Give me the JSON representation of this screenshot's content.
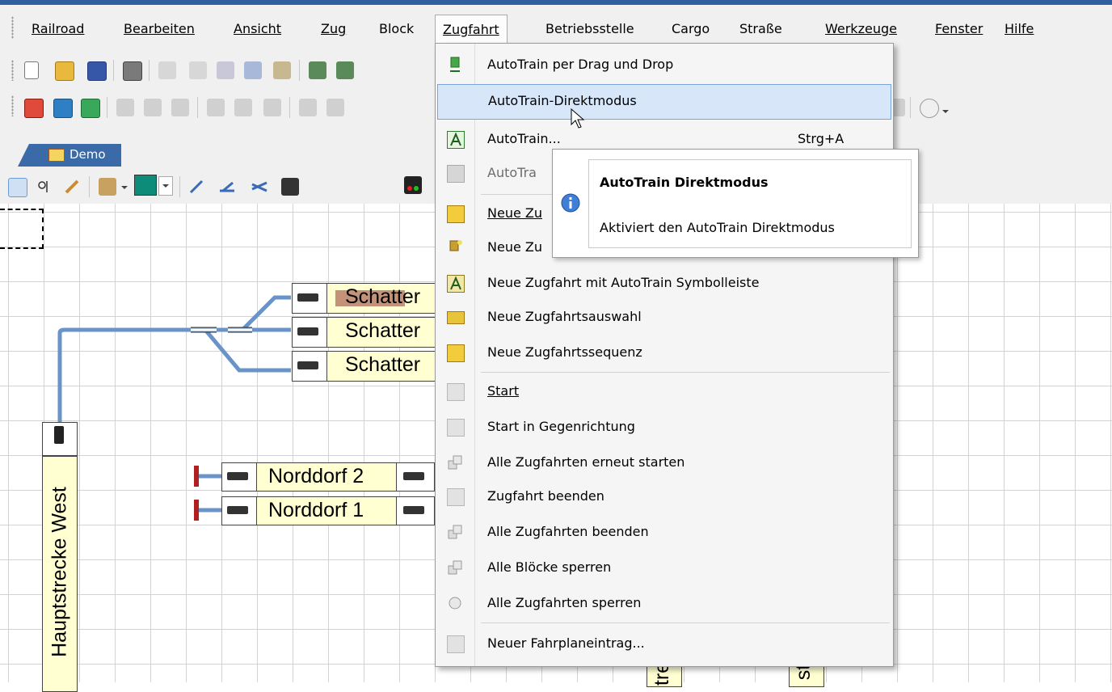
{
  "menubar": {
    "items": [
      {
        "label": "Railroad"
      },
      {
        "label": "Bearbeiten"
      },
      {
        "label": "Ansicht"
      },
      {
        "label": "Zug"
      },
      {
        "label": "Block"
      },
      {
        "label": "Zugfahrt"
      },
      {
        "label": "Betriebsstelle"
      },
      {
        "label": "Cargo"
      },
      {
        "label": "Straße"
      },
      {
        "label": "Werkzeuge"
      },
      {
        "label": "Fenster"
      },
      {
        "label": "Hilfe"
      }
    ]
  },
  "document_tab": {
    "label": "Demo"
  },
  "layout": {
    "blocks": [
      {
        "label": "Schatter"
      },
      {
        "label": "Schatter"
      },
      {
        "label": "Schatter"
      },
      {
        "label": "Norddorf 2"
      },
      {
        "label": "Norddorf 1"
      },
      {
        "label": "Hauptstrecke West"
      },
      {
        "label": "tre"
      },
      {
        "label": "st"
      }
    ]
  },
  "zugfahrt_menu": {
    "items": [
      {
        "label": "AutoTrain per Drag und Drop",
        "icon": "autotrain-drag-icon"
      },
      {
        "label": "AutoTrain-Direktmodus",
        "icon": "none"
      },
      {
        "label": "AutoTrain...",
        "shortcut": "Strg+A",
        "icon": "autotrain-a-icon"
      },
      {
        "label": "AutoTra",
        "icon": "autotrain-disabled-icon"
      },
      {
        "label": "Neue Zu",
        "icon": "new-route-icon"
      },
      {
        "label": "Neue Zu",
        "icon": "new-route-wizard-icon"
      },
      {
        "label": "Neue Zugfahrt mit AutoTrain Symbolleiste",
        "icon": "new-route-autotrain-icon"
      },
      {
        "label": "Neue Zugfahrtsauswahl",
        "icon": "route-selection-icon"
      },
      {
        "label": "Neue Zugfahrtssequenz",
        "icon": "route-sequence-icon"
      },
      {
        "label": "Start",
        "icon": "start-icon"
      },
      {
        "label": "Start in Gegenrichtung",
        "icon": "start-reverse-icon"
      },
      {
        "label": "Alle Zugfahrten erneut starten",
        "icon": "restart-all-icon"
      },
      {
        "label": "Zugfahrt beenden",
        "icon": "stop-route-icon"
      },
      {
        "label": "Alle Zugfahrten beenden",
        "icon": "stop-all-icon"
      },
      {
        "label": "Alle Blöcke sperren",
        "icon": "lock-blocks-icon"
      },
      {
        "label": "Alle Zugfahrten sperren",
        "icon": "lock-routes-icon"
      },
      {
        "label": "Neuer Fahrplaneintrag...",
        "icon": "timetable-icon"
      }
    ]
  },
  "tooltip": {
    "title": "AutoTrain Direktmodus",
    "body": "Aktiviert den AutoTrain Direktmodus",
    "icon": "info-icon"
  },
  "colors": {
    "accent": "#2f5d9e",
    "highlight": "#d7e6f8",
    "track": "#6a93c8",
    "block_fill": "#ffffd2"
  }
}
